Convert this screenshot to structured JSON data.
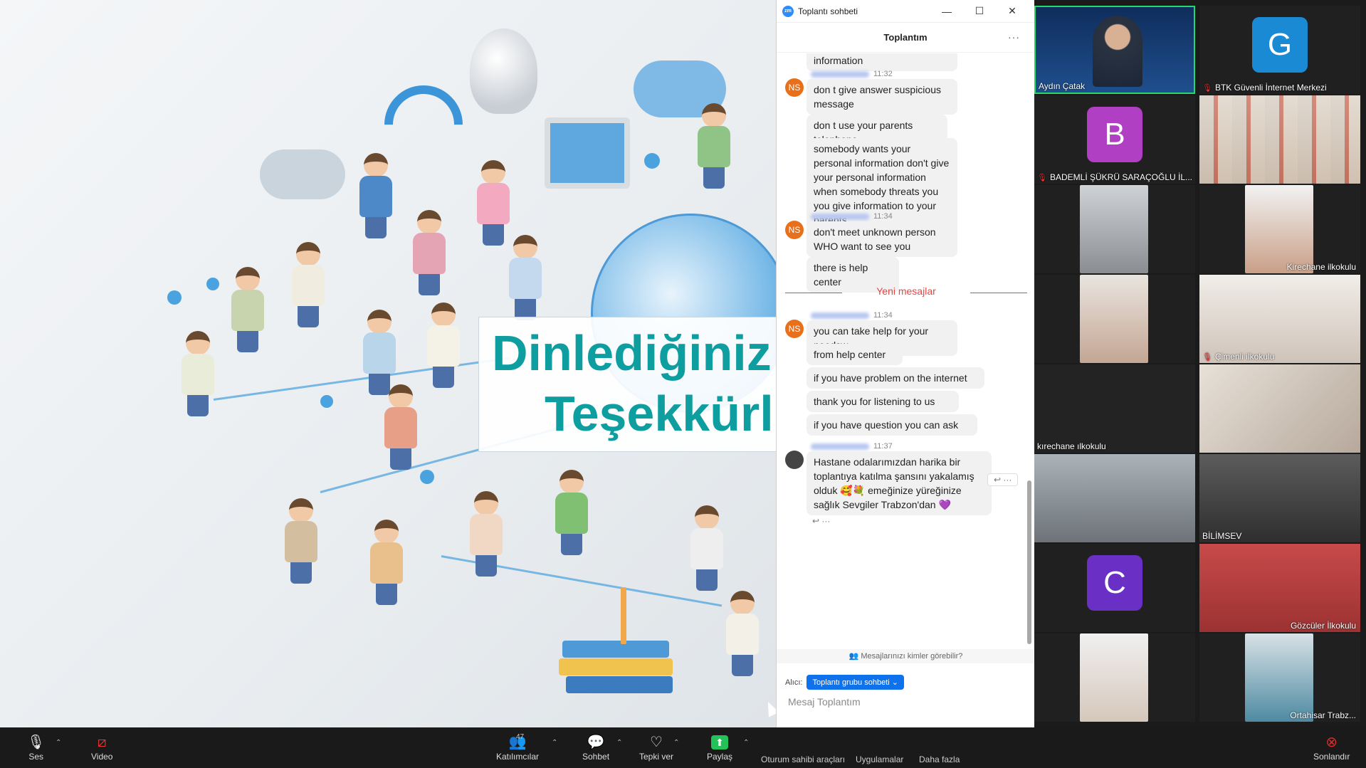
{
  "shared_screen": {
    "title_line1": "Dinlediğiniz",
    "title_line2": "Teşekkürl"
  },
  "chat": {
    "window_title": "Toplantı sohbeti",
    "meeting_name": "Toplantım",
    "messages": [
      {
        "text": "information"
      },
      {
        "time": "11:32",
        "avatar": "NS",
        "text": "don t give answer suspicious message"
      },
      {
        "text": "don t use your parents telephone"
      },
      {
        "text": "somebody wants your personal information don't give your personal information when somebody threats you you give information to your parents"
      },
      {
        "time": "11:34",
        "avatar": "NS",
        "text": "don't meet unknown person WHO want to see you"
      },
      {
        "text": "there is help center"
      },
      {
        "time": "11:34",
        "avatar": "NS",
        "text": "you can take help for your needsw"
      },
      {
        "text": "from help center"
      },
      {
        "text": "if you have problem on the internet"
      },
      {
        "text": "thank you for listening to us"
      },
      {
        "text": "if you have question you can ask"
      },
      {
        "time": "11:37",
        "text": "Hastane odalarımızdan harika bir toplantıya katılma şansını yakalamış olduk 🥰💐 emeğinize yüreğinize sağlık Sevgiler Trabzon'dan 💜"
      }
    ],
    "new_messages_label": "Yeni mesajlar",
    "who_can_see": "Mesajlarınızı kimler görebilir?",
    "recipient_label": "Alıcı:",
    "recipient_value": "Toplantı grubu sohbeti ⌄",
    "input_placeholder": "Mesaj Toplantım"
  },
  "gallery": {
    "tiles": [
      {
        "name": "Aydın Çatak"
      },
      {
        "name": "BTK Güvenli İnternet Merkezi",
        "initial": "G",
        "color": "#1a8ad4"
      },
      {
        "name": "BADEMLİ ŞÜKRÜ SARAÇOĞLU İL...",
        "initial": "B",
        "color": "#b03fc4"
      },
      {
        "name": "Kirechane ilkokulu"
      },
      {
        "name": "Çimenli ilkokulu"
      },
      {
        "name": "kırechane ılkokulu"
      },
      {
        "name": "BİLİMSEV"
      },
      {
        "initial": "C",
        "color": "#6a2fc4"
      },
      {
        "name": "Gözcüler İlkokulu"
      },
      {
        "name": "Ortahisar Trabz..."
      }
    ]
  },
  "toolbar": {
    "audio": "Ses",
    "video": "Video",
    "participants": "Katılımcılar",
    "participants_count": "47",
    "chat": "Sohbet",
    "react": "Tepki ver",
    "share": "Paylaş",
    "host_tools": "Oturum sahibi araçları",
    "apps": "Uygulamalar",
    "more": "Daha fazla",
    "end": "Sonlandır"
  },
  "colors": {
    "accent_blue": "#0e72ed",
    "title_teal": "#0e9ea0",
    "new_messages_red": "#e24444",
    "active_speaker": "#23d96e"
  }
}
